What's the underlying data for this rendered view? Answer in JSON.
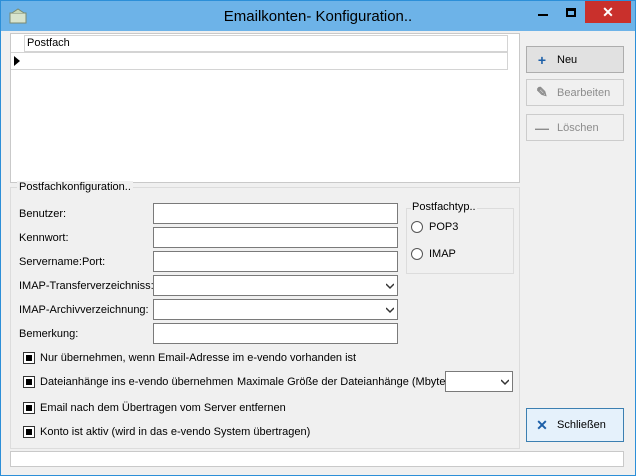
{
  "window": {
    "title": "Emailkonten- Konfiguration.."
  },
  "grid": {
    "column_header": "Postfach"
  },
  "config": {
    "group_label": "Postfachkonfiguration..",
    "fields": {
      "user_label": "Benutzer:",
      "password_label": "Kennwort:",
      "server_label": "Servername:Port:",
      "imap_transfer_label": "IMAP-Transferverzeichniss:",
      "imap_archive_label": "IMAP-Archivverzeichnung:",
      "remark_label": "Bemerkung:"
    },
    "type_group": {
      "label": "Postfachtyp..",
      "pop3": "POP3",
      "imap": "IMAP"
    },
    "checks": {
      "only_if_exists": "Nur übernehmen, wenn Email-Adresse im e-vendo vorhanden ist",
      "attachments": "Dateianhänge ins e-vendo übernehmen",
      "delete_after_transfer": "Email nach dem Übertragen vom Server entfernen",
      "account_active": "Konto ist aktiv (wird in das e-vendo System übertragen)"
    },
    "max_attachment_label": "Maximale Größe der Dateianhänge (Mbyte):"
  },
  "buttons": {
    "new": "Neu",
    "edit": "Bearbeiten",
    "delete": "Löschen",
    "close": "Schließen"
  },
  "colors": {
    "titlebar": "#6db3e8",
    "close_button": "#c9302c",
    "accent_blue": "#1c5fa8"
  }
}
